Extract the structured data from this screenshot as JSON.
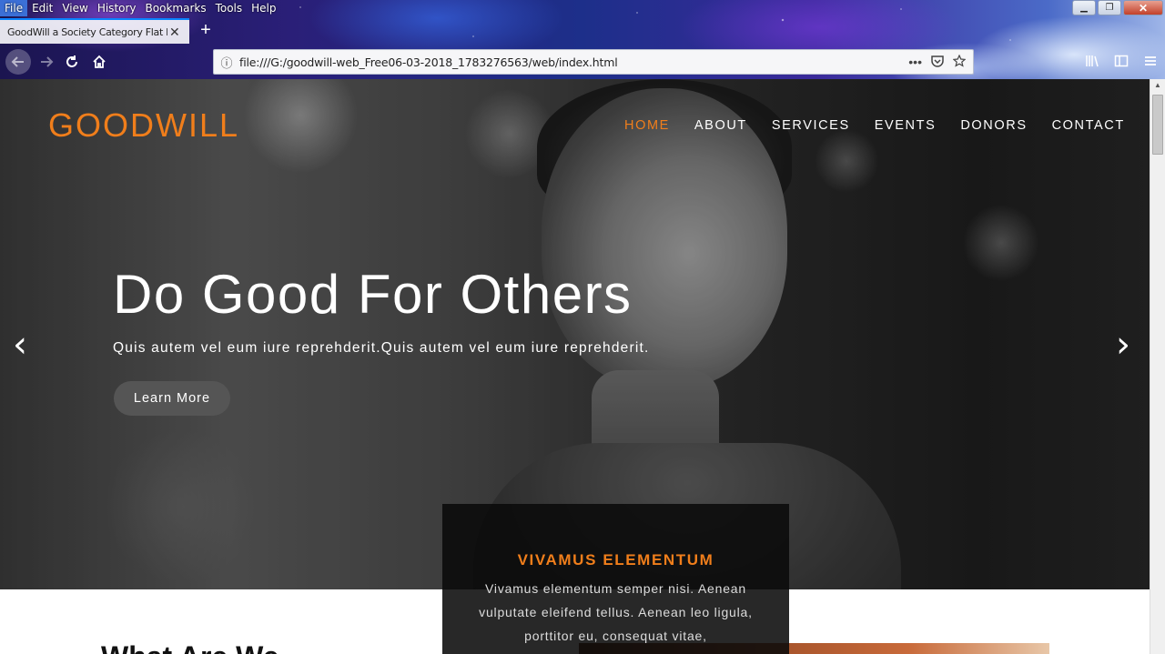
{
  "browser": {
    "menu": [
      "File",
      "Edit",
      "View",
      "History",
      "Bookmarks",
      "Tools",
      "Help"
    ],
    "tab_title": "GoodWill a Society Category Flat Bootstrap",
    "url": "file:///G:/goodwill-web_Free06-03-2018_1783276563/web/index.html",
    "url_info_icon": "ⓘ",
    "more_icon": "•••",
    "tab_close": "✕",
    "new_tab": "+",
    "win": {
      "minimize": "▁",
      "maximize": "❐",
      "close": "✕"
    }
  },
  "site": {
    "logo": "GOODWILL",
    "nav": [
      "HOME",
      "ABOUT",
      "SERVICES",
      "EVENTS",
      "DONORS",
      "CONTACT"
    ],
    "accent_color": "#f07e1b"
  },
  "hero": {
    "title": "Do Good For Others",
    "subtitle": "Quis autem vel eum iure reprehderit.Quis autem vel eum iure reprehderit.",
    "button": "Learn More",
    "prev": "‹",
    "next": "›"
  },
  "feature": {
    "title": "VIVAMUS ELEMENTUM",
    "text": "Vivamus elementum semper nisi. Aenean vulputate eleifend tellus. Aenean leo ligula, porttitor eu, consequat vitae,"
  },
  "section": {
    "heading": "What Are We"
  }
}
